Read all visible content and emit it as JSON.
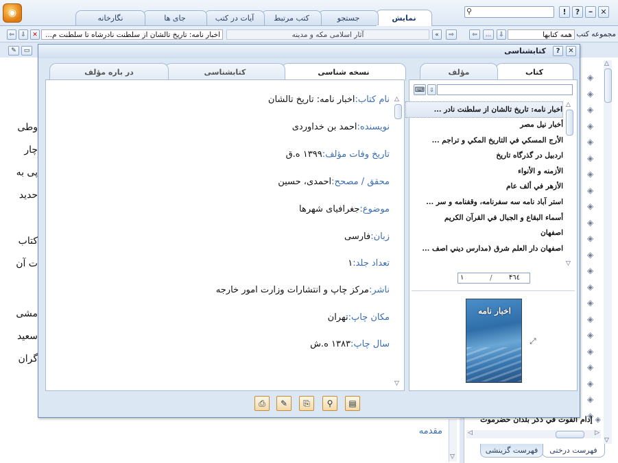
{
  "top_tabs": [
    {
      "label": "نمایش",
      "active": true
    },
    {
      "label": "جستجو",
      "active": false
    },
    {
      "label": "کتب مرتبط",
      "active": false
    },
    {
      "label": "آیات در کتب",
      "active": false
    },
    {
      "label": "جای ها",
      "active": false
    },
    {
      "label": "نگارخانه",
      "active": false
    }
  ],
  "window_controls": {
    "close": "✕",
    "minimize": "━",
    "help": "?",
    "info": "!"
  },
  "address": {
    "current_title": "اخبار نامه: تاریخ تالشان از سلطنت نادرشاه تا سلطنت م...",
    "secondary_title": "آثار اسلامی مکه و مدینه",
    "collection_label": "مجموعه کتب",
    "collection_value": "همه کتابها",
    "ellipsis": "..."
  },
  "dialog": {
    "title": "کتابشناسی",
    "right_tabs": [
      "کتاب",
      "مؤلف"
    ],
    "main_tabs": [
      "نسخه شناسی",
      "کتابشناسی",
      "در باره مؤلف"
    ],
    "active_main_tab": "نسخه شناسی"
  },
  "book_fields": [
    {
      "label": "نام کتاب:",
      "value": "اخبار نامه: تاریخ تالشان"
    },
    {
      "label": "نویسنده:",
      "value": "احمد بن خداوردی"
    },
    {
      "label": "تاریخ وفات مؤلف:",
      "value": "۱۳۹۹ ه.ق"
    },
    {
      "label": "محقق / مصحح:",
      "value": "احمدی، حسین"
    },
    {
      "label": "موضوع:",
      "value": "جغرافیای شهرها"
    },
    {
      "label": "زبان:",
      "value": "فارسی"
    },
    {
      "label": "تعداد جلد:",
      "value": "۱"
    },
    {
      "label": "ناشر:",
      "value": "مرکز چاپ و انتشارات وزارت امور خارجه"
    },
    {
      "label": "مکان چاپ:",
      "value": "تهران"
    },
    {
      "label": "سال چاپ:",
      "value": "۱۳۸۳ ه.ش"
    }
  ],
  "book_list": [
    "اخبار نامه: تاریخ تالشان از سلطنت نادر ...",
    "أخبار نيل مصر",
    "الأرج المسكي في التاريخ المكي و تراجم ...",
    "اردبيل در گذرگاه تاريخ",
    "الأزمنه و الأنواء",
    "الأزهر في ألف عام",
    "استر آباد نامه سه سفرنامه، وقفنامه و سر ...",
    "أسماء البقاع و الجبال في القرآن الكريم",
    "اصفهان",
    "اصفهان دار العلم شرق (مدارس ديني اصف ..."
  ],
  "pager": {
    "current": "۱",
    "total": "۴٦٤"
  },
  "cover": {
    "title": "اخبار نامه"
  },
  "background_text": [
    "وطی",
    "چار",
    "پی به",
    "حدید",
    "کتاب",
    "ت آن",
    "مشی",
    "سعید",
    "گران"
  ],
  "background_link": "مقدمه",
  "right_panel_bottom_item": "إدام القوت في ذكر بلدان حضرموت",
  "bottom_tabs": [
    "فهرست درختی",
    "فهرست گزینشی"
  ],
  "colors": {
    "accent_blue": "#3b6db3",
    "dialog_border": "#6d8fbf",
    "tab_bg": "#d3e1f1"
  }
}
